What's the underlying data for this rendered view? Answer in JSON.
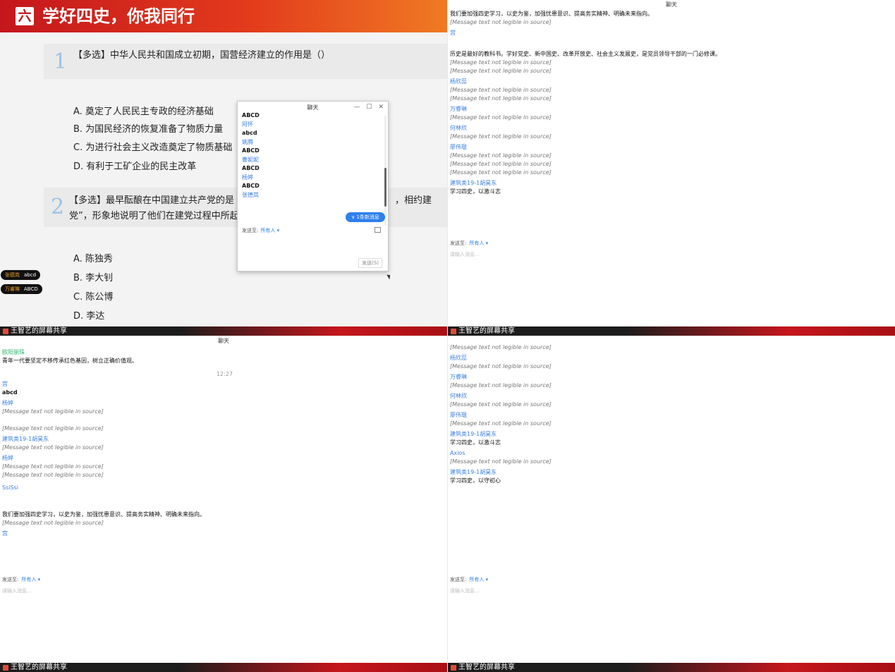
{
  "slide": {
    "badge": "六",
    "title": "学好四史，你我同行",
    "q1": {
      "num": "1",
      "text": "【多选】中华人民共和国成立初期，国营经济建立的作用是（）",
      "options": [
        "A. 奠定了人民民主专政的经济基础",
        "B. 为国民经济的恢复准备了物质力量",
        "C. 为进行社会主义改造奠定了物质基础",
        "D. 有利于工矿企业的民主改革"
      ]
    },
    "q2": {
      "num": "2",
      "text_line1": "【多选】最早酝酿在中国建立共产党的是",
      "text_line1_right": "，相约建",
      "text_line2": "党”，形象地说明了他们在建党过程中所起",
      "options": [
        "A. 陈独秀",
        "B. 李大钊",
        "C. 陈公博",
        "D. 李达"
      ]
    },
    "chat": {
      "title": "聊天",
      "min": "—",
      "max": "☐",
      "close": "✕",
      "messages": [
        {
          "user": "",
          "text": "ABCD"
        },
        {
          "user": "阿怀",
          "text": "abcd"
        },
        {
          "user": "姚腾",
          "text": "ABCD"
        },
        {
          "user": "曹妮妮",
          "text": "ABCD"
        },
        {
          "user": "杨婷",
          "text": "ABCD"
        },
        {
          "user": "张德岚",
          "text": ""
        }
      ],
      "new_msg": "∨ 1条新消息",
      "send_to_label": "发送至:",
      "send_to_value": "所有人 ▾",
      "send_button": "发送(S)"
    },
    "pills": [
      {
        "name": "张德岚",
        "value": "abcd"
      },
      {
        "name": "万睿琳",
        "value": "ABCD"
      }
    ],
    "share_label": "王智艺的屏幕共享"
  },
  "panel2": {
    "title": "聊天",
    "items": [
      {
        "user": "",
        "text": "我们要加强四史学习，以史为鉴，加强忧患意识、提高务实精神、明确未来指向。"
      },
      {
        "user": "",
        "text": "[Message text not legible in source]"
      },
      {
        "user": "宫",
        "text": ""
      },
      {
        "user": "",
        "text": "历史是最好的教科书。学好党史、新中国史、改革开放史、社会主义发展史，是党员领导干部的一门必修课。"
      },
      {
        "user": "",
        "text": "[Message text not legible in source]"
      },
      {
        "user": "",
        "text": "[Message text not legible in source]"
      },
      {
        "user": "杨欣蕊",
        "text": "[Message text not legible in source]"
      },
      {
        "user": "",
        "text": "[Message text not legible in source]"
      },
      {
        "user": "万睿琳",
        "text": "[Message text not legible in source]"
      },
      {
        "user": "何林欣",
        "text": "[Message text not legible in source]"
      },
      {
        "user": "廖伟琨",
        "text": "[Message text not legible in source]"
      },
      {
        "user": "",
        "text": "[Message text not legible in source]"
      },
      {
        "user": "",
        "text": "[Message text not legible in source]"
      },
      {
        "user": "建筑类19-1胡昊东",
        "text": "学习四史，以激斗志"
      }
    ],
    "send_to_label": "发送至:",
    "send_to_value": "所有人 ▾",
    "input_placeholder": "请输入消息...",
    "share_label": "王智艺的屏幕共享"
  },
  "panel3": {
    "title": "聊天",
    "items": [
      {
        "user": "欧阳丽珠",
        "green": true,
        "text": "青年一代要坚定不移传承红色基因，树立正确价值观。"
      },
      {
        "time": "12:27"
      },
      {
        "user": "宫",
        "text": "abcd",
        "bold": true
      },
      {
        "user": "杨婷",
        "text": "[Message text not legible in source]"
      },
      {
        "user": "",
        "text": "[Message text not legible in source]"
      },
      {
        "user": "建筑类19-1胡昊东",
        "text": "[Message text not legible in source]"
      },
      {
        "user": "杨婷",
        "text": "[Message text not legible in source]"
      },
      {
        "user": "",
        "text": "[Message text not legible in source]"
      },
      {
        "user": "SsiSsi",
        "text": ""
      },
      {
        "user": "",
        "text": "我们要加强四史学习，以史为鉴，加强忧患意识、提高务实精神、明确未来指向。"
      },
      {
        "user": "",
        "text": "[Message text not legible in source]"
      },
      {
        "user": "宫",
        "text": ""
      }
    ],
    "send_to_label": "发送至:",
    "send_to_value": "所有人 ▾",
    "input_placeholder": "请输入消息...",
    "share_label": "王智艺的屏幕共享"
  },
  "panel4": {
    "title": "聊天",
    "items": [
      {
        "user": "",
        "text": "[Message text not legible in source]"
      },
      {
        "user": "杨欣蕊",
        "text": "[Message text not legible in source]"
      },
      {
        "user": "万睿琳",
        "text": "[Message text not legible in source]"
      },
      {
        "user": "何林欣",
        "text": "[Message text not legible in source]"
      },
      {
        "user": "廖伟琨",
        "text": "[Message text not legible in source]"
      },
      {
        "user": "建筑类19-1胡昊东",
        "text": "学习四史，以激斗志"
      },
      {
        "user": "Axios",
        "text": "[Message text not legible in source]"
      },
      {
        "user": "建筑类19-1胡昊东",
        "text": "学习四史，以守初心"
      }
    ],
    "send_to_label": "发送至:",
    "send_to_value": "所有人 ▾",
    "input_placeholder": "请输入消息...",
    "share_label": "王智艺的屏幕共享"
  },
  "colors": {
    "accent_red": "#c4161c",
    "accent_orange": "#f07a23",
    "link_blue": "#3b7fe0",
    "green_user": "#2fb36e"
  }
}
